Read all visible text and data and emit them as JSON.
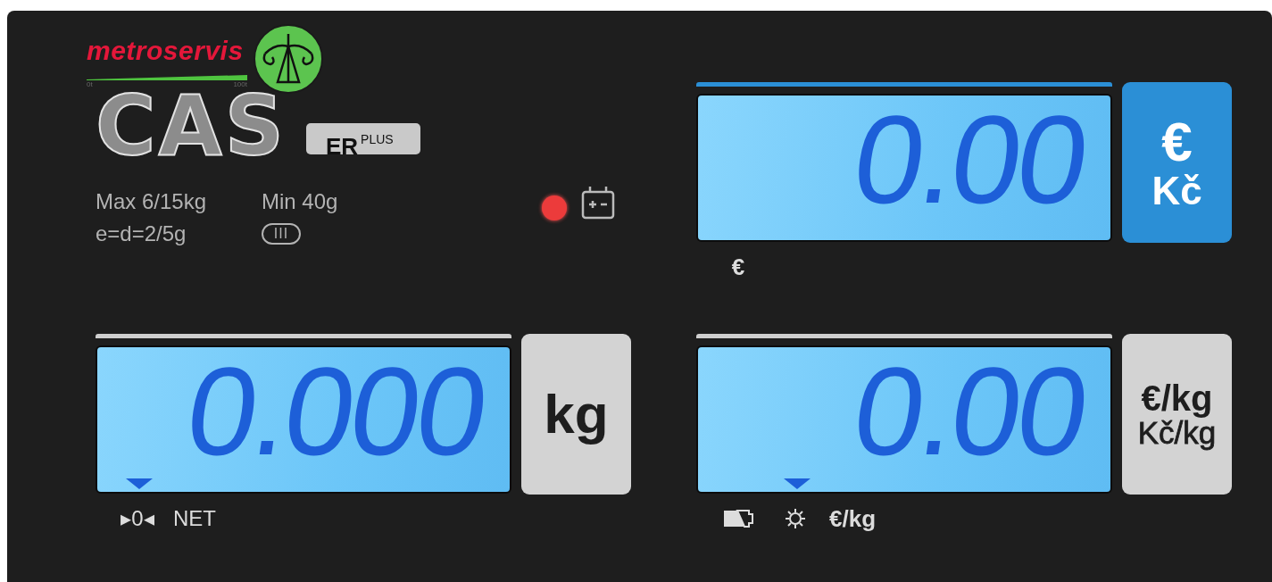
{
  "brand": {
    "logo_text": "metroservis",
    "scale_start": "0t",
    "scale_end": "100t",
    "model": "CAS",
    "variant": "ER$^{PLUS}$"
  },
  "status": {
    "led_on": true
  },
  "specs": [
    "Max 6/15kg",
    "Min 40g",
    "e=d=2/5g"
  ],
  "accuracy_class": "III",
  "displays": [
    {
      "kind": "price",
      "value": "0.00",
      "active": true,
      "units": [
        "€",
        "Kč"
      ],
      "indicators": [
        {
          "kind": "label",
          "text": "€",
          "pointer": false
        }
      ]
    },
    {
      "kind": "weight",
      "value": "0.000",
      "active": false,
      "units": [
        "kg"
      ],
      "indicators": [
        {
          "kind": "label",
          "text": "▸0◂",
          "pointer": true
        },
        {
          "kind": "label",
          "text": "NET",
          "pointer": false
        }
      ]
    },
    {
      "kind": "unit-price",
      "value": "0.00",
      "active": false,
      "units": [
        "€/kg",
        "Kč/kg"
      ],
      "indicators": [
        {
          "kind": "battery",
          "pointer": false
        },
        {
          "kind": "sun",
          "pointer": true
        },
        {
          "kind": "label",
          "text": "€/kg",
          "pointer": false
        }
      ]
    }
  ]
}
